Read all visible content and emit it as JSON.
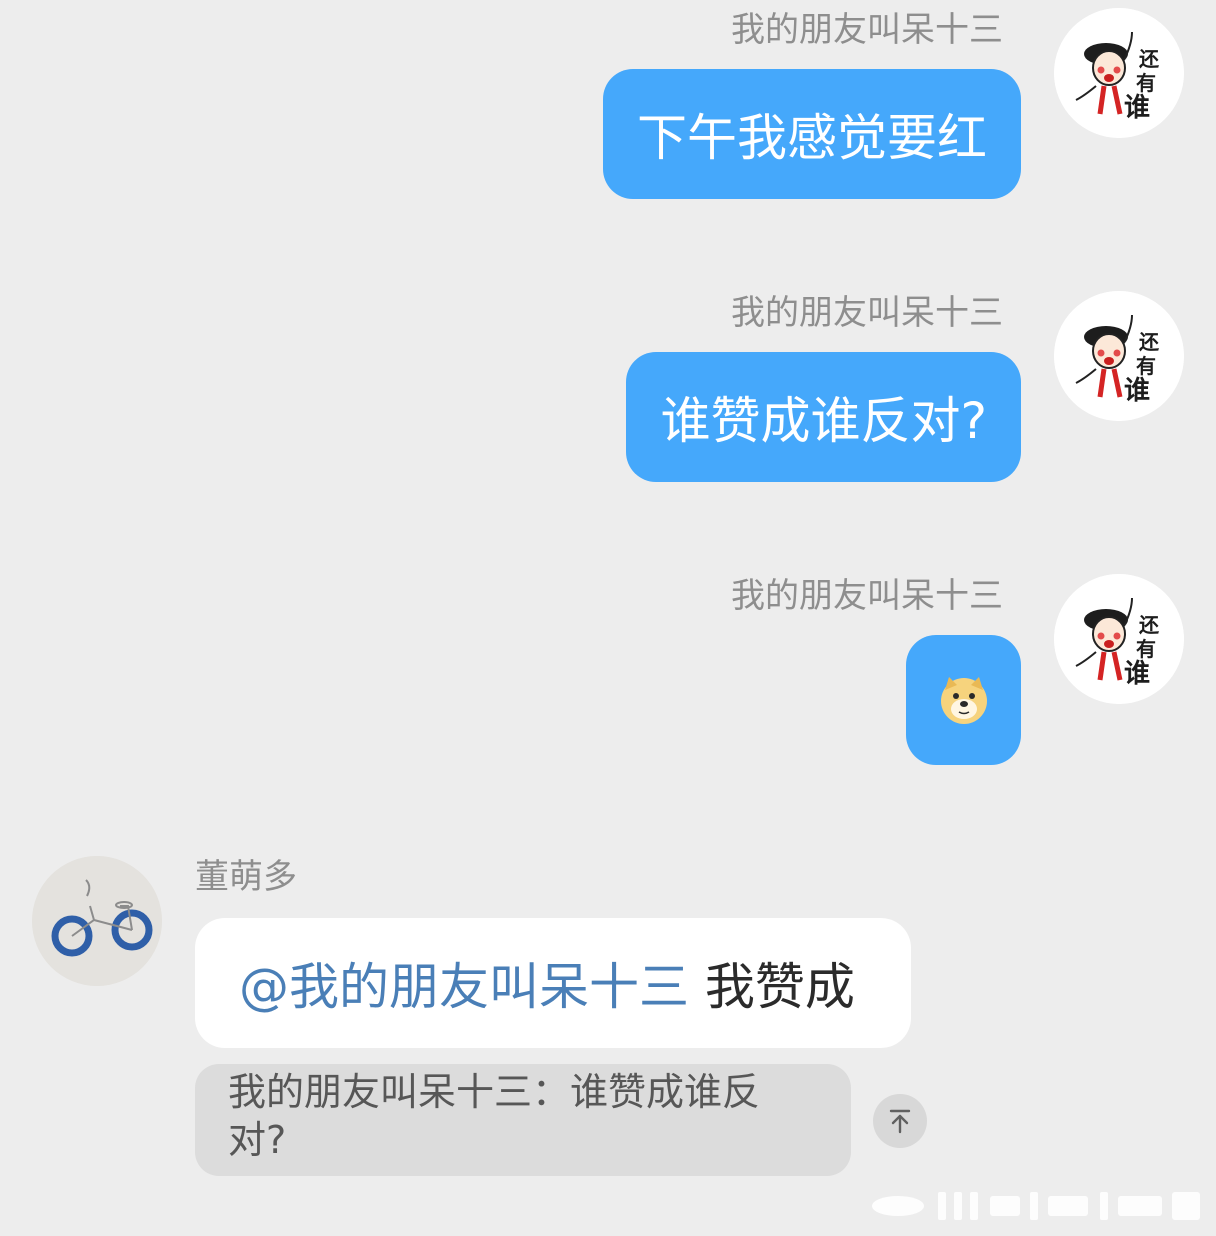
{
  "messages": [
    {
      "sender": "我的朋友叫呆十三",
      "text": "下午我感觉要红"
    },
    {
      "sender": "我的朋友叫呆十三",
      "text": "谁赞成谁反对?"
    },
    {
      "sender": "我的朋友叫呆十三",
      "emoji": "doge-emoji"
    }
  ],
  "my_avatar": {
    "text_line1": "还",
    "text_line2": "有",
    "text_line3": "谁"
  },
  "reply": {
    "sender": "董萌多",
    "mention": "@我的朋友叫呆十三",
    "text": " 我赞成",
    "quote_line1": "我的朋友叫呆十三：谁赞成谁反",
    "quote_line2": "对?"
  },
  "colors": {
    "background": "#ededed",
    "outgoing_bubble": "#45a8fb",
    "incoming_bubble": "#ffffff",
    "mention": "#4a7fb7",
    "name": "#8e8e8e"
  },
  "icons": {
    "quote_jump": "arrow-up-to-top-icon",
    "watermark": "weibo-watermark"
  }
}
